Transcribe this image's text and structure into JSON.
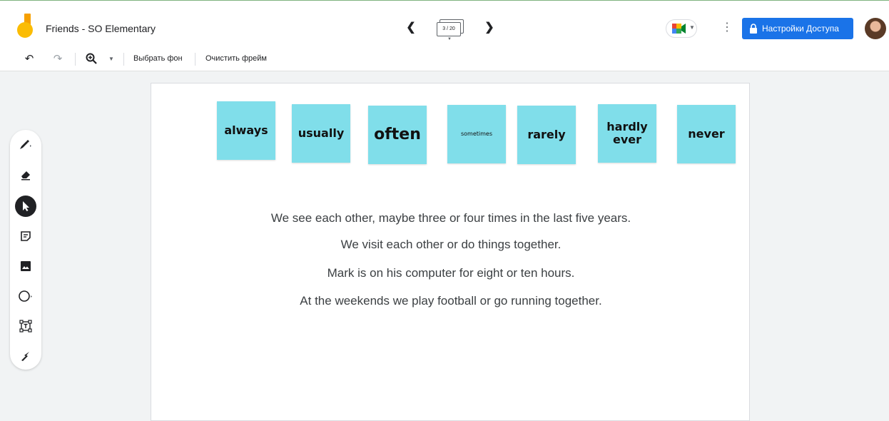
{
  "header": {
    "doc_title": "Friends - SO Elementary",
    "frame_counter": "3 / 20",
    "share_label": "Настройки Доступа"
  },
  "toolbar": {
    "choose_background": "Выбрать фон",
    "clear_frame": "Очистить фрейм"
  },
  "sidebar": {
    "tools": [
      "pen-icon",
      "eraser-icon",
      "select-icon",
      "sticky-note-icon",
      "image-icon",
      "circle-icon",
      "text-box-icon",
      "laser-icon"
    ]
  },
  "canvas": {
    "notes": [
      {
        "text": "always"
      },
      {
        "text": "usually"
      },
      {
        "text": "often"
      },
      {
        "text": "sometimes"
      },
      {
        "text": "rarely"
      },
      {
        "text": "hardly ever"
      },
      {
        "text": "never"
      }
    ],
    "sentences": [
      "We see each other, maybe three or four times in the last five years.",
      "We visit each other or do things together.",
      "Mark is on his computer for eight or ten hours.",
      "At the weekends we play football or go running together."
    ]
  },
  "colors": {
    "accent": "#1a73e8",
    "note": "#80deea",
    "logo": "#fbbc04"
  }
}
